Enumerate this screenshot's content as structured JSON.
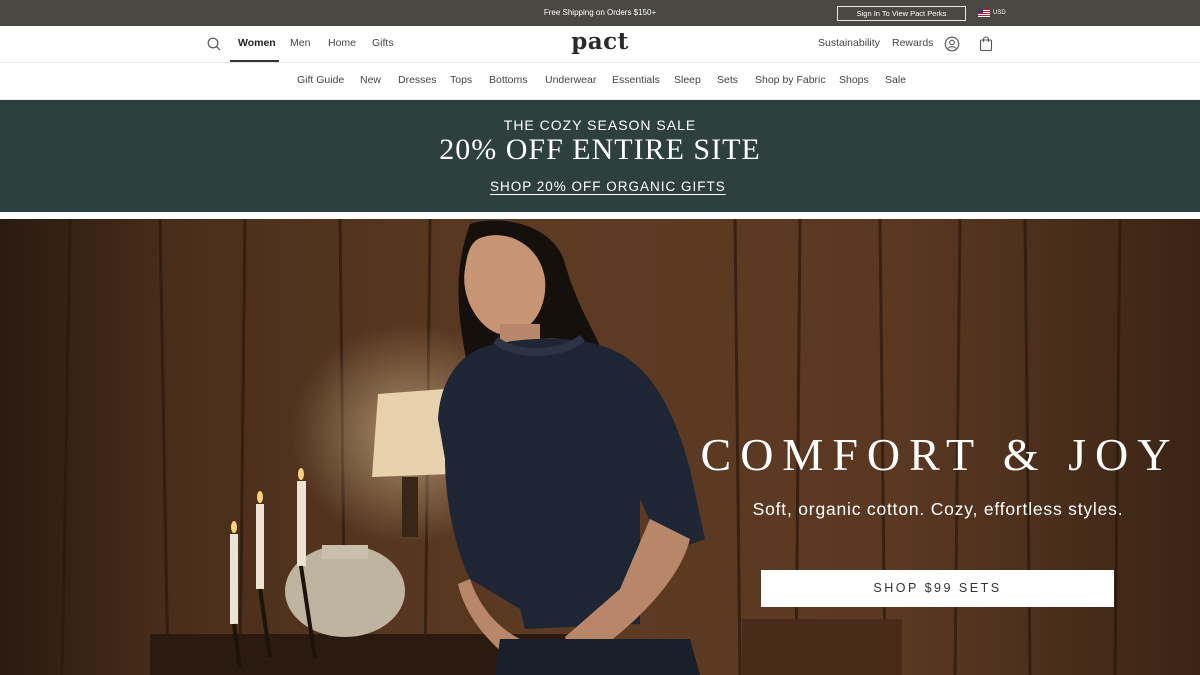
{
  "topbar": {
    "shipping": "Free Shipping on Orders $150+",
    "signin": "Sign In To View Pact Perks",
    "currency": "USD"
  },
  "header": {
    "primary_nav": [
      "Women",
      "Men",
      "Home",
      "Gifts"
    ],
    "active_nav": "Women",
    "logo": "pact",
    "right_links": [
      "Sustainability",
      "Rewards"
    ],
    "icons": [
      "search-icon",
      "account-icon",
      "cart-icon",
      "us-flag-icon"
    ]
  },
  "subnav": {
    "items": [
      "Gift Guide",
      "New",
      "Dresses",
      "Tops",
      "Bottoms",
      "Underwear",
      "Essentials",
      "Sleep",
      "Sets",
      "Shop by Fabric",
      "Shops",
      "Sale"
    ]
  },
  "promo": {
    "eyebrow": "THE COZY SEASON SALE",
    "headline": "20% OFF ENTIRE SITE",
    "cta": "SHOP 20% OFF ORGANIC GIFTS",
    "background": "#2e403e"
  },
  "hero": {
    "title": "COMFORT & JOY",
    "subtitle": "Soft, organic cotton. Cozy, effortless styles.",
    "button": "SHOP $99 SETS"
  },
  "colors": {
    "topbar": "#4a4842",
    "promo": "#2e403e",
    "wood": "#5a3a24"
  }
}
